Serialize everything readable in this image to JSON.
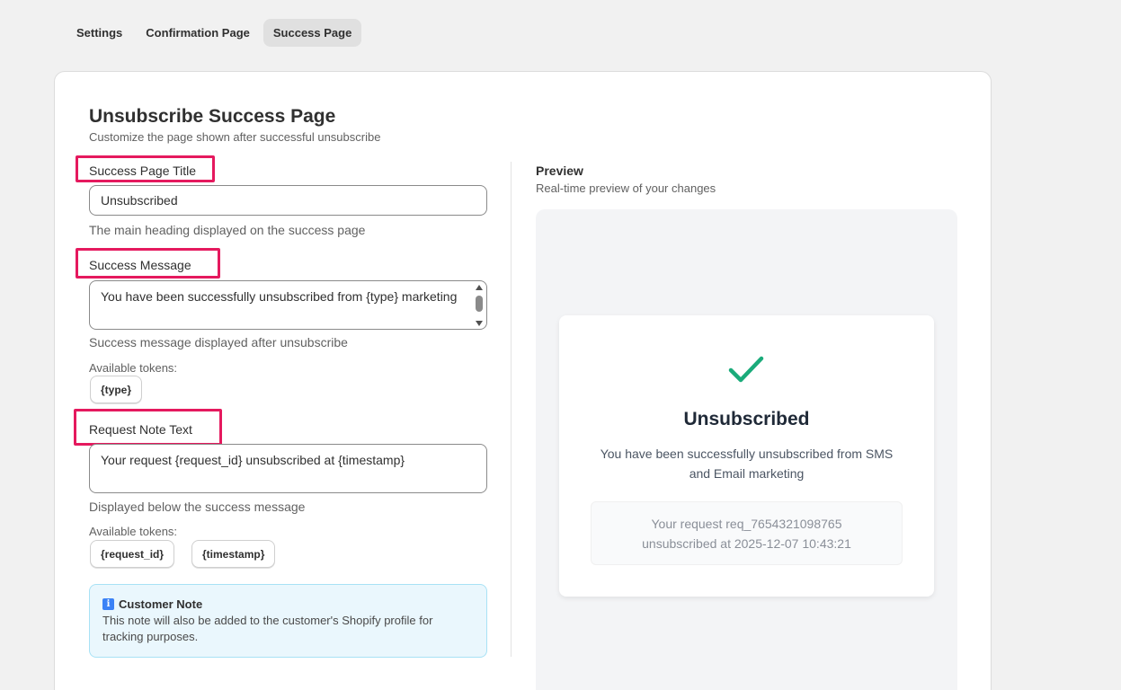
{
  "tabs": [
    {
      "label": "Settings",
      "active": false
    },
    {
      "label": "Confirmation Page",
      "active": false
    },
    {
      "label": "Success Page",
      "active": true
    }
  ],
  "header": {
    "title": "Unsubscribe Success Page",
    "subtitle": "Customize the page shown after successful unsubscribe"
  },
  "form": {
    "success_title": {
      "label": "Success Page Title",
      "value": "Unsubscribed",
      "help": "The main heading displayed on the success page"
    },
    "success_message": {
      "label": "Success Message",
      "value": "You have been successfully unsubscribed from {type} marketing",
      "help": "Success message displayed after unsubscribe",
      "tokens_label": "Available tokens:",
      "tokens": [
        "{type}"
      ]
    },
    "request_note": {
      "label": "Request Note Text",
      "value": "Your request {request_id} unsubscribed at {timestamp}",
      "help": "Displayed below the success message",
      "tokens_label": "Available tokens:",
      "tokens": [
        "{request_id}",
        "{timestamp}"
      ]
    }
  },
  "customer_note": {
    "icon": "info-icon",
    "title": "Customer Note",
    "text": "This note will also be added to the customer's Shopify profile for tracking purposes."
  },
  "preview": {
    "title": "Preview",
    "subtitle": "Real-time preview of your changes",
    "card": {
      "icon": "check-icon",
      "heading": "Unsubscribed",
      "message": "You have been successfully unsubscribed from SMS and Email marketing",
      "note_line1": "Your request req_7654321098765",
      "note_line2": "unsubscribed at 2025-12-07 10:43:21"
    }
  },
  "colors": {
    "highlight": "#e5195e",
    "check": "#1aab7a",
    "note_bg": "#eaf7fd"
  }
}
